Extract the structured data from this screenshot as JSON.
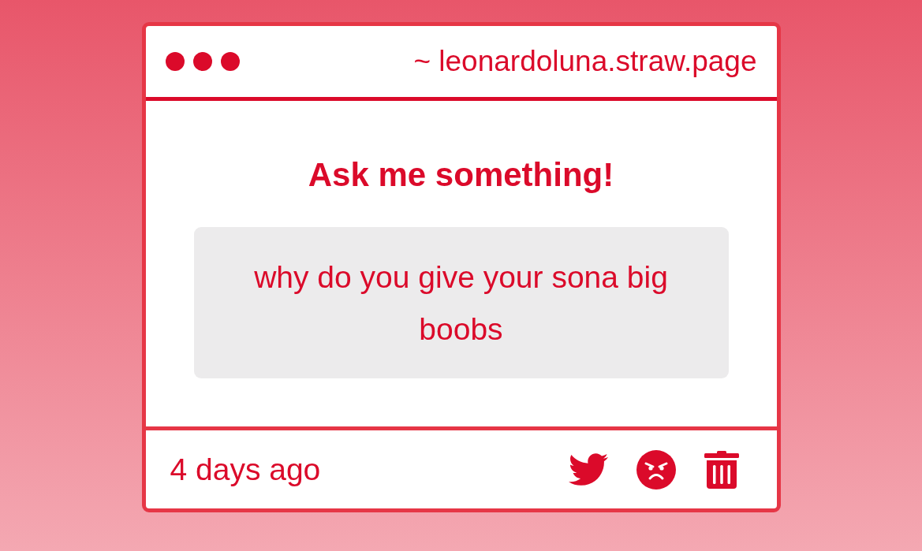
{
  "window": {
    "url": "~ leonardoluna.straw.page"
  },
  "prompt": {
    "title": "Ask me something!"
  },
  "question": {
    "text": "why do you give your sona big boobs"
  },
  "footer": {
    "time": "4 days ago",
    "actions": [
      {
        "kind": "bird"
      },
      {
        "kind": "angry"
      },
      {
        "kind": "delete"
      }
    ]
  }
}
